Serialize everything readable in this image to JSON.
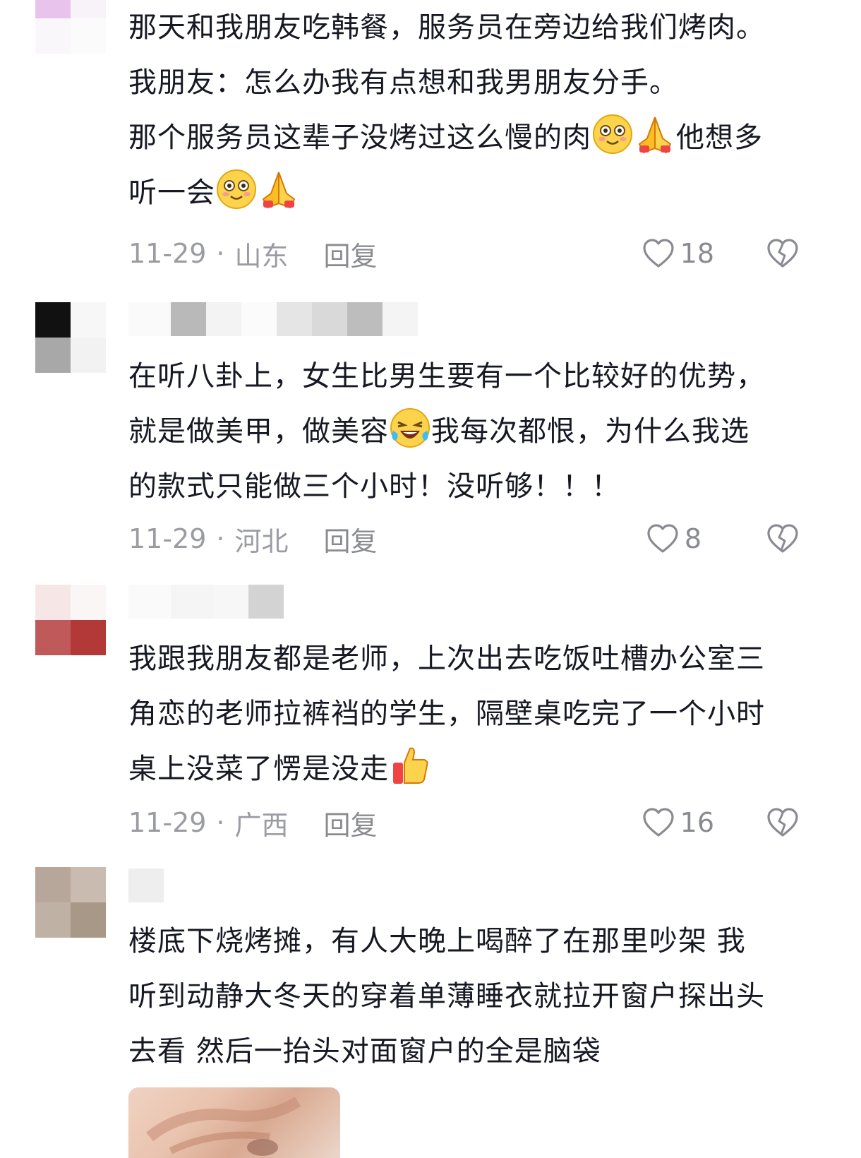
{
  "comments": [
    {
      "lines": [
        "那天和我朋友吃韩餐，服务员在旁边给我们烤肉。",
        "我朋友：怎么办我有点想和我男朋友分手。",
        "那个服务员这辈子没烤过这么慢的肉",
        "他想多",
        "听一会"
      ],
      "date": "11-29",
      "location": "山东",
      "reply_label": "回复",
      "likes": "18"
    },
    {
      "lines": [
        "在听八卦上，女生比男生要有一个比较好的优势，",
        "就是做美甲，做美容",
        "我每次都恨，为什么我选",
        "的款式只能做三个小时！没听够！！！"
      ],
      "date": "11-29",
      "location": "河北",
      "reply_label": "回复",
      "likes": "8"
    },
    {
      "lines": [
        "我跟我朋友都是老师，上次出去吃饭吐槽办公室三",
        "角恋的老师拉裤裆的学生，隔壁桌吃完了一个小时",
        "桌上没菜了愣是没走"
      ],
      "date": "11-29",
      "location": "广西",
      "reply_label": "回复",
      "likes": "16"
    },
    {
      "lines": [
        "楼底下烧烤摊，有人大晚上喝醉了在那里吵架 我",
        "听到动静大冬天的穿着单薄睡衣就拉开窗户探出头",
        "去看 然后一抬头对面窗户的全是脑袋"
      ]
    }
  ],
  "meta_separator": "·",
  "icons": {
    "emoji_smile": "smiling-face-icon",
    "emoji_pray": "folded-hands-icon",
    "emoji_laugh": "laughing-tears-icon",
    "emoji_thumb": "thumbs-up-icon",
    "like": "heart-outline-icon",
    "dislike": "broken-heart-icon"
  },
  "colors": {
    "text": "#161823",
    "meta": "#9b9ca3",
    "icon": "#8a8b92"
  }
}
